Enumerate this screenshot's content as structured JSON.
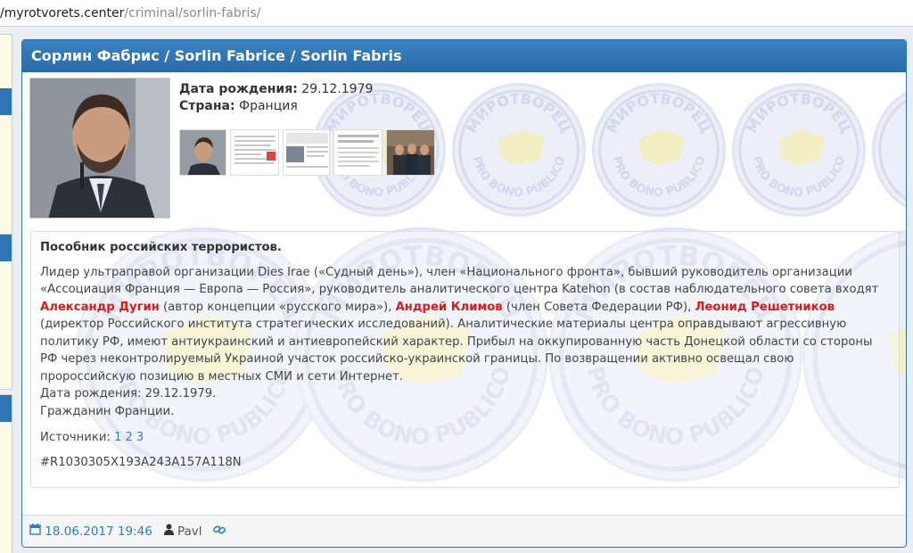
{
  "address_bar": {
    "host": "/myrotvorets.center",
    "path": "/criminal/sorlin-fabris/"
  },
  "profile": {
    "title": "Сорлин Фабрис / Sorlin Fabrice / Sorlin Fabris",
    "birth_label": "Дата рождения:",
    "birth_value": "29.12.1979",
    "country_label": "Страна:",
    "country_value": "Франция"
  },
  "description": {
    "heading": "Пособник российских террористов.",
    "p1": "Лидер ультраправой организации Dies Irae («Судный день»), член «Национального фронта», бывший руководитель организации «Ассоциация Франция — Европа — Россия», руководитель аналитического центра Katehon (в состав наблюдательного совета входят ",
    "link1": "Александр Дугин",
    "p2": " (автор концепции «русского мира»), ",
    "link2": "Андрей Климов",
    "p3": " (член Совета Федерации РФ), ",
    "link3": "Леонид Решетников",
    "p4": " (директор Российского института стратегических исследований). Аналитические материалы центра оправдывают агрессивную политику РФ, имеют антиукраинский и антиевропейский характер. Прибыл на оккупированную часть Донецкой области со стороны РФ через неконтролируемый Украиной участок российско-украинской границы. По возвращении активно освещал свою пророссийскую позицию в местных СМИ и сети Интернет.",
    "birth_line": "Дата рождения:  29.12.1979.",
    "citizen_line": "Гражданин Франции.",
    "sources_label": "Источники:",
    "sources": [
      "1",
      "2",
      "3"
    ],
    "hash": "#R1030305X193A243A157A118N"
  },
  "footer": {
    "date": "18.06.2017 19:46",
    "author": "Pavl"
  },
  "watermark": {
    "top_text": "МИРОТВОРЕЦ",
    "bottom_text": "PRO BONO PUBLICO"
  },
  "colors": {
    "header_blue": "#2f75b5",
    "link_red": "#d81b1b",
    "link_blue": "#2a7cc7"
  }
}
